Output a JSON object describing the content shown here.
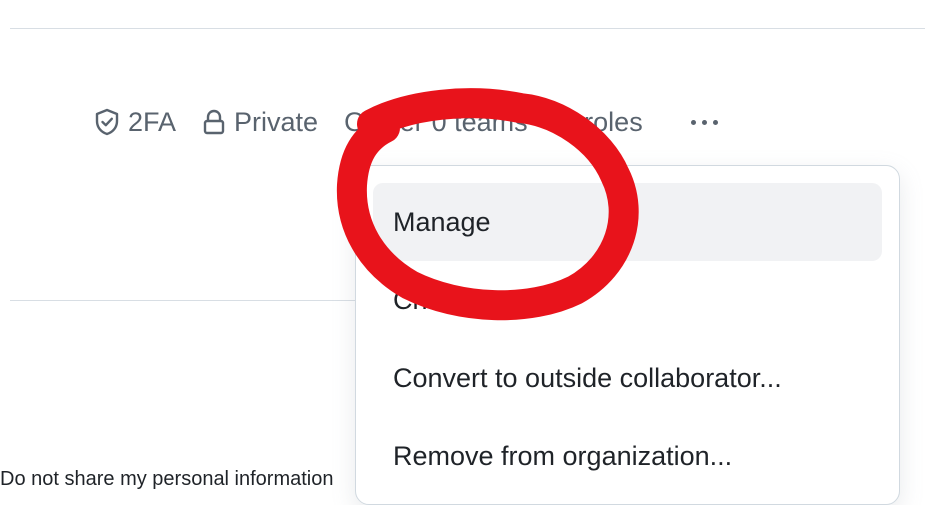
{
  "member_meta": {
    "two_factor_label": "2FA",
    "visibility_label": "Private",
    "role_label": "Owner",
    "teams_label": "0 teams",
    "roles_label": "0 roles"
  },
  "member_menu": {
    "items": [
      {
        "label": "Manage"
      },
      {
        "label": "Change role..."
      },
      {
        "label": "Convert to outside collaborator..."
      },
      {
        "label": "Remove from organization..."
      }
    ]
  },
  "footer": {
    "privacy_text": "Do not share my personal information"
  },
  "colors": {
    "muted_text": "#59636e",
    "menu_hover": "#f1f2f4",
    "annotation_red": "#e8131b"
  },
  "icons": {
    "two_factor": "shield-check-icon",
    "visibility": "lock-icon",
    "more": "kebab-horizontal-icon"
  }
}
